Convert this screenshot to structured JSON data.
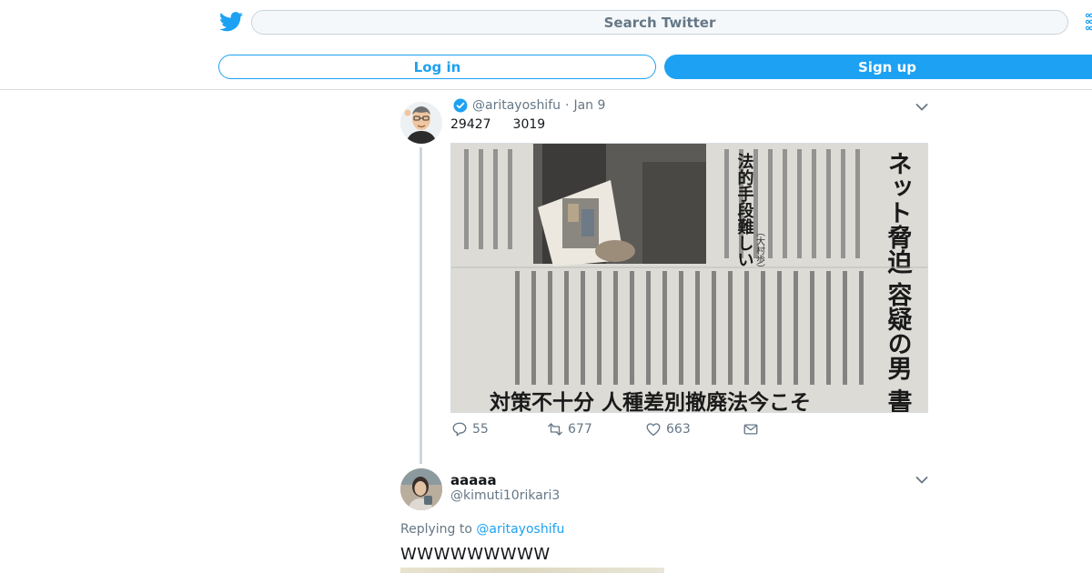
{
  "header": {
    "search_placeholder": "Search Twitter",
    "login_label": "Log in",
    "signup_label": "Sign up",
    "brand_color": "#1da1f2"
  },
  "tweet1": {
    "handle": "@aritayoshifu",
    "date": "Jan 9",
    "count_a": "29427",
    "count_b": "3019",
    "replies": "55",
    "retweets": "677",
    "likes": "663",
    "image": {
      "headline_right": "ネット脅迫 容疑の男 書類送検",
      "headline_left": "法的手段難しい",
      "headline_bottom": "対策不十分 人種差別撤廃法今こそ",
      "credit": "（大村歩）"
    }
  },
  "tweet2": {
    "name": "aaaaa",
    "handle": "@kimuti10rikari3",
    "replying_prefix": "Replying to",
    "replying_to": "@aritayoshifu",
    "text": "WWWWWWWWW"
  },
  "icons": {
    "logo": "twitter-bird-icon",
    "verified": "verified-badge-icon",
    "reply": "reply-icon",
    "retweet": "retweet-icon",
    "like": "heart-icon",
    "dm": "envelope-icon",
    "caret": "chevron-down-icon"
  }
}
